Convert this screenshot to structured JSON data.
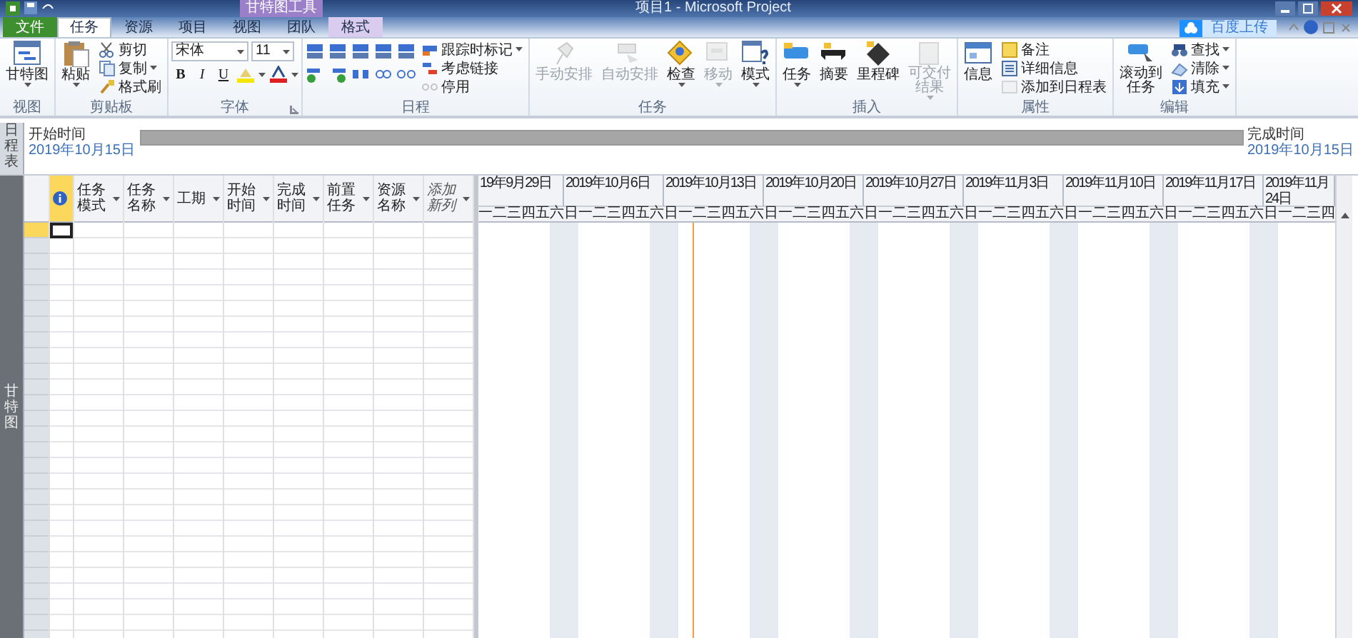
{
  "window": {
    "title": "项目1 - Microsoft Project",
    "contextual_group": "甘特图工具"
  },
  "tabs": [
    {
      "label": "文件",
      "kind": "file",
      "selected": false
    },
    {
      "label": "任务",
      "kind": "normal",
      "selected": true
    },
    {
      "label": "资源",
      "kind": "normal",
      "selected": false
    },
    {
      "label": "项目",
      "kind": "normal",
      "selected": false
    },
    {
      "label": "视图",
      "kind": "normal",
      "selected": false
    },
    {
      "label": "团队",
      "kind": "normal",
      "selected": false
    },
    {
      "label": "格式",
      "kind": "contextual",
      "selected": false
    }
  ],
  "upload_button": {
    "label": "百度上传"
  },
  "ribbon_groups": [
    {
      "label": "视图",
      "launcher": false,
      "items": [
        {
          "kind": "large",
          "label": "甘特图",
          "dropdown": true,
          "disabled": false
        }
      ]
    },
    {
      "label": "剪贴板",
      "launcher": false,
      "items": [
        {
          "kind": "large",
          "label": "粘贴",
          "dropdown": true,
          "disabled": false
        },
        {
          "kind": "stack",
          "rows": [
            {
              "label": "剪切",
              "dropdown": false,
              "disabled": false
            },
            {
              "label": "复制",
              "dropdown": true,
              "disabled": false
            },
            {
              "label": "格式刷",
              "dropdown": false,
              "disabled": false
            }
          ]
        }
      ]
    },
    {
      "label": "字体",
      "launcher": true,
      "items": [
        {
          "kind": "font",
          "font": "宋体",
          "size": "11",
          "styles": [
            {
              "label": "B",
              "kind": "bold"
            },
            {
              "label": "I",
              "kind": "italic"
            },
            {
              "label": "U",
              "kind": "underline"
            }
          ]
        }
      ]
    },
    {
      "label": "日程",
      "launcher": false,
      "items": [
        {
          "kind": "schedule_icons"
        },
        {
          "kind": "stack",
          "rows": [
            {
              "label": "跟踪时标记",
              "dropdown": true,
              "disabled": false
            },
            {
              "label": "考虑链接",
              "dropdown": false,
              "disabled": false
            },
            {
              "label": "停用",
              "dropdown": false,
              "disabled": true
            }
          ]
        }
      ]
    },
    {
      "label": "任务",
      "launcher": false,
      "items": [
        {
          "kind": "large",
          "label": "手动安排",
          "dropdown": false,
          "disabled": true
        },
        {
          "kind": "large",
          "label": "自动安排",
          "dropdown": false,
          "disabled": true
        },
        {
          "kind": "large",
          "label": "检查",
          "dropdown": true,
          "disabled": false
        },
        {
          "kind": "large",
          "label": "移动",
          "dropdown": true,
          "disabled": true
        },
        {
          "kind": "large",
          "label": "模式",
          "dropdown": true,
          "disabled": false
        }
      ]
    },
    {
      "label": "插入",
      "launcher": false,
      "items": [
        {
          "kind": "large",
          "label": "任务",
          "dropdown": true,
          "disabled": false
        },
        {
          "kind": "large",
          "label": "摘要",
          "dropdown": false,
          "disabled": false
        },
        {
          "kind": "large",
          "label": "里程碑",
          "dropdown": false,
          "disabled": false
        },
        {
          "kind": "large",
          "label": "可交付结果",
          "dropdown": true,
          "disabled": true
        }
      ]
    },
    {
      "label": "属性",
      "launcher": false,
      "items": [
        {
          "kind": "large",
          "label": "信息",
          "dropdown": false,
          "disabled": false
        },
        {
          "kind": "stack",
          "rows": [
            {
              "label": "备注",
              "dropdown": false,
              "disabled": false
            },
            {
              "label": "详细信息",
              "dropdown": false,
              "disabled": false
            },
            {
              "label": "添加到日程表",
              "dropdown": false,
              "disabled": true
            }
          ]
        }
      ]
    },
    {
      "label": "编辑",
      "launcher": false,
      "items": [
        {
          "kind": "large",
          "label": "滚动到任务",
          "dropdown": false,
          "disabled": false
        },
        {
          "kind": "stack",
          "rows": [
            {
              "label": "查找",
              "dropdown": true,
              "disabled": false
            },
            {
              "label": "清除",
              "dropdown": true,
              "disabled": false
            },
            {
              "label": "填充",
              "dropdown": true,
              "disabled": false
            }
          ]
        }
      ]
    }
  ],
  "timeline": {
    "side_label": "日程表",
    "start_label": "开始时间",
    "start_date": "2019年10月15日",
    "finish_label": "完成时间",
    "finish_date": "2019年10月15日"
  },
  "view_label": "甘特图",
  "table": {
    "columns": [
      {
        "kind": "indicator",
        "selected": true
      },
      {
        "kind": "field",
        "label": "任务模式",
        "selected": false
      },
      {
        "kind": "field",
        "label": "任务名称",
        "selected": false
      },
      {
        "kind": "field",
        "label": "工期",
        "selected": false
      },
      {
        "kind": "field",
        "label": "开始时间",
        "selected": false
      },
      {
        "kind": "field",
        "label": "完成时间",
        "selected": false
      },
      {
        "kind": "field",
        "label": "前置任务",
        "selected": false
      },
      {
        "kind": "field",
        "label": "资源名称",
        "selected": false
      },
      {
        "kind": "add",
        "label": "添加新列",
        "selected": false
      }
    ]
  },
  "gantt": {
    "weeks": [
      {
        "label": "19年9月29日",
        "days": [
          {
            "label": "一",
            "kind": "work"
          },
          {
            "label": "二",
            "kind": "work"
          },
          {
            "label": "三",
            "kind": "work"
          },
          {
            "label": "四",
            "kind": "work"
          },
          {
            "label": "五",
            "kind": "work"
          },
          {
            "label": "六",
            "kind": "off"
          }
        ]
      },
      {
        "label": "2019年10月6日",
        "days": [
          {
            "label": "日",
            "kind": "off"
          },
          {
            "label": "一",
            "kind": "work"
          },
          {
            "label": "二",
            "kind": "work"
          },
          {
            "label": "三",
            "kind": "work"
          },
          {
            "label": "四",
            "kind": "work"
          },
          {
            "label": "五",
            "kind": "work"
          },
          {
            "label": "六",
            "kind": "off"
          }
        ]
      },
      {
        "label": "2019年10月13日",
        "days": [
          {
            "label": "日",
            "kind": "off"
          },
          {
            "label": "一",
            "kind": "work"
          },
          {
            "label": "二",
            "kind": "today"
          },
          {
            "label": "三",
            "kind": "work"
          },
          {
            "label": "四",
            "kind": "work"
          },
          {
            "label": "五",
            "kind": "work"
          },
          {
            "label": "六",
            "kind": "off"
          }
        ]
      },
      {
        "label": "2019年10月20日",
        "days": [
          {
            "label": "日",
            "kind": "off"
          },
          {
            "label": "一",
            "kind": "work"
          },
          {
            "label": "二",
            "kind": "work"
          },
          {
            "label": "三",
            "kind": "work"
          },
          {
            "label": "四",
            "kind": "work"
          },
          {
            "label": "五",
            "kind": "work"
          },
          {
            "label": "六",
            "kind": "off"
          }
        ]
      },
      {
        "label": "2019年10月27日",
        "days": [
          {
            "label": "日",
            "kind": "off"
          },
          {
            "label": "一",
            "kind": "work"
          },
          {
            "label": "二",
            "kind": "work"
          },
          {
            "label": "三",
            "kind": "work"
          },
          {
            "label": "四",
            "kind": "work"
          },
          {
            "label": "五",
            "kind": "work"
          },
          {
            "label": "六",
            "kind": "off"
          }
        ]
      },
      {
        "label": "2019年11月3日",
        "days": [
          {
            "label": "日",
            "kind": "off"
          },
          {
            "label": "一",
            "kind": "work"
          },
          {
            "label": "二",
            "kind": "work"
          },
          {
            "label": "三",
            "kind": "work"
          },
          {
            "label": "四",
            "kind": "work"
          },
          {
            "label": "五",
            "kind": "work"
          },
          {
            "label": "六",
            "kind": "off"
          }
        ]
      },
      {
        "label": "2019年11月10日",
        "days": [
          {
            "label": "日",
            "kind": "off"
          },
          {
            "label": "一",
            "kind": "work"
          },
          {
            "label": "二",
            "kind": "work"
          },
          {
            "label": "三",
            "kind": "work"
          },
          {
            "label": "四",
            "kind": "work"
          },
          {
            "label": "五",
            "kind": "work"
          },
          {
            "label": "六",
            "kind": "off"
          }
        ]
      },
      {
        "label": "2019年11月17日",
        "days": [
          {
            "label": "日",
            "kind": "off"
          },
          {
            "label": "一",
            "kind": "work"
          },
          {
            "label": "二",
            "kind": "work"
          },
          {
            "label": "三",
            "kind": "work"
          },
          {
            "label": "四",
            "kind": "work"
          },
          {
            "label": "五",
            "kind": "work"
          },
          {
            "label": "六",
            "kind": "off"
          }
        ]
      },
      {
        "label": "2019年11月24日",
        "days": [
          {
            "label": "日",
            "kind": "off"
          },
          {
            "label": "一",
            "kind": "work"
          },
          {
            "label": "二",
            "kind": "work"
          },
          {
            "label": "三",
            "kind": "work"
          },
          {
            "label": "四",
            "kind": "work"
          }
        ]
      }
    ]
  }
}
